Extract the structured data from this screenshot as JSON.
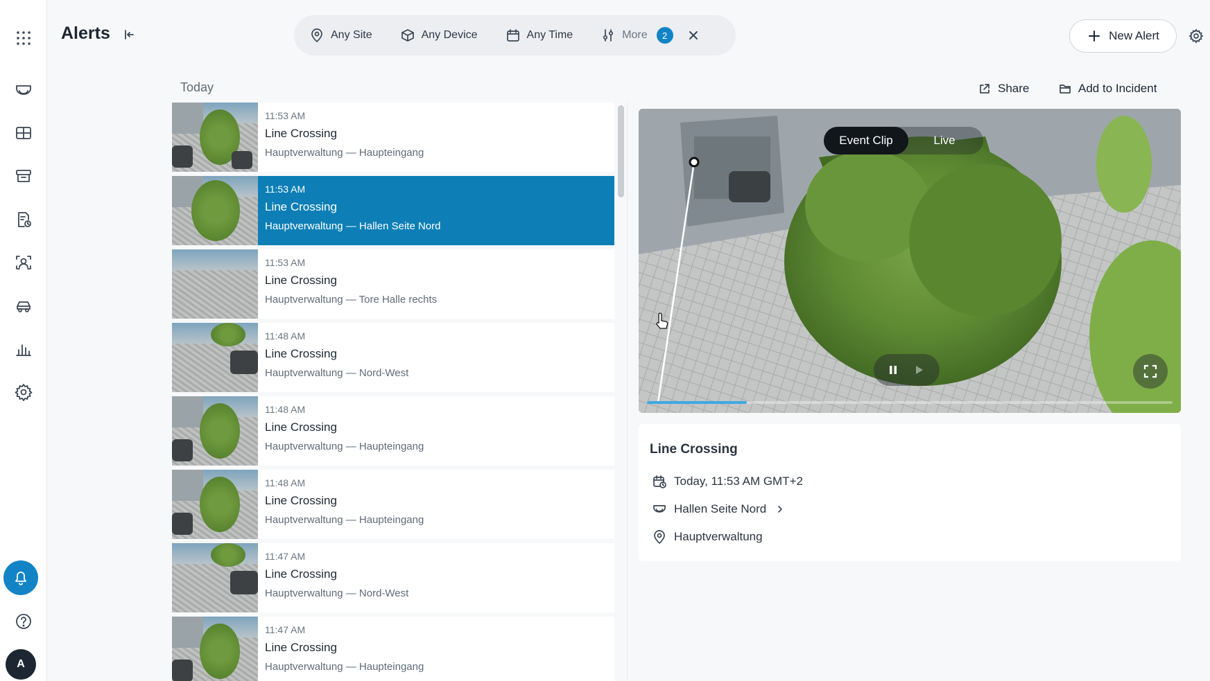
{
  "app": {
    "page_title": "Alerts"
  },
  "filters": {
    "site": "Any Site",
    "device": "Any Device",
    "time": "Any Time",
    "more": "More",
    "more_count": "2"
  },
  "header": {
    "new_alert_label": "New Alert"
  },
  "list": {
    "section_label": "Today",
    "items": [
      {
        "time": "11:53 AM",
        "title": "Line Crossing",
        "location": "Hauptverwaltung — Haupteingang",
        "selected": false
      },
      {
        "time": "11:53 AM",
        "title": "Line Crossing",
        "location": "Hauptverwaltung — Hallen Seite Nord",
        "selected": true
      },
      {
        "time": "11:53 AM",
        "title": "Line Crossing",
        "location": "Hauptverwaltung — Tore Halle rechts",
        "selected": false
      },
      {
        "time": "11:48 AM",
        "title": "Line Crossing",
        "location": "Hauptverwaltung — Nord-West",
        "selected": false
      },
      {
        "time": "11:48 AM",
        "title": "Line Crossing",
        "location": "Hauptverwaltung — Haupteingang",
        "selected": false
      },
      {
        "time": "11:48 AM",
        "title": "Line Crossing",
        "location": "Hauptverwaltung — Haupteingang",
        "selected": false
      },
      {
        "time": "11:47 AM",
        "title": "Line Crossing",
        "location": "Hauptverwaltung — Nord-West",
        "selected": false
      },
      {
        "time": "11:47 AM",
        "title": "Line Crossing",
        "location": "Hauptverwaltung — Haupteingang",
        "selected": false
      }
    ]
  },
  "detail": {
    "share_label": "Share",
    "incident_label": "Add to Incident",
    "player": {
      "event_clip_label": "Event Clip",
      "live_label": "Live",
      "progress": 0.19
    },
    "title": "Line Crossing",
    "datetime": "Today, 11:53 AM GMT+2",
    "camera": "Hallen Seite Nord",
    "site": "Hauptverwaltung"
  },
  "user": {
    "initial": "A"
  },
  "colors": {
    "accent": "#1284c6",
    "selected_row": "#0d7fb6"
  }
}
